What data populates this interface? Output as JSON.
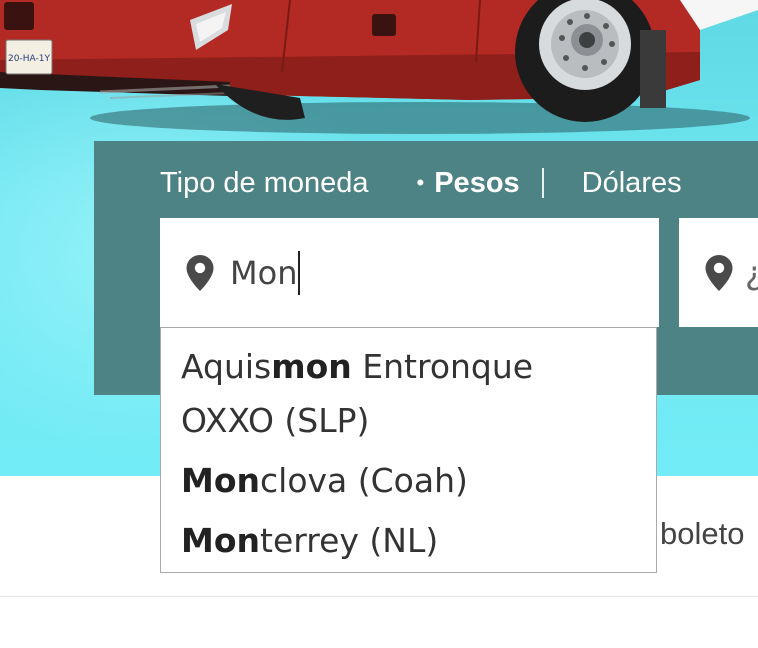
{
  "vehicle": {
    "plate": "20-HA-1Y"
  },
  "currency": {
    "label": "Tipo de moneda",
    "bullet": "•",
    "option_selected": "Pesos",
    "option_other": "Dólares"
  },
  "search": {
    "origin_value": "Mon",
    "destination_value": "¿"
  },
  "autocomplete": {
    "options": [
      {
        "pre": "Aquis",
        "match": "mon",
        "post": " Entronque OXXO (SLP)"
      },
      {
        "pre": "",
        "match": "Mon",
        "post": "clova (Coah)"
      },
      {
        "pre": "",
        "match": "Mon",
        "post": "terrey (NL)"
      }
    ]
  },
  "page": {
    "partial_text": "boleto"
  },
  "colors": {
    "panel": "#4e8385",
    "hero_bg": "#6ee6f0",
    "bus_red": "#b22a23"
  }
}
